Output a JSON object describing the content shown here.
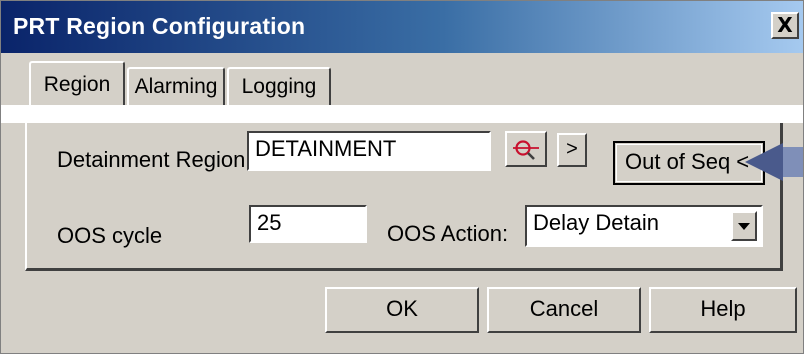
{
  "window": {
    "title": "PRT Region Configuration",
    "close_label": "X"
  },
  "tabs": [
    {
      "label": "Region",
      "active": true
    },
    {
      "label": "Alarming",
      "active": false
    },
    {
      "label": "Logging",
      "active": false
    }
  ],
  "region_tab": {
    "detainment_region_label": "Detainment Region:",
    "detainment_region_value": "DETAINMENT",
    "lookup_icon": "magnifier-icon",
    "next_button_label": ">",
    "out_of_seq_button_label": "Out of Seq <<",
    "oos_cycle_label": "OOS cycle",
    "oos_cycle_value": "25",
    "oos_action_label": "OOS Action:",
    "oos_action_value": "Delay Detain"
  },
  "footer": {
    "ok_label": "OK",
    "cancel_label": "Cancel",
    "help_label": "Help"
  },
  "colors": {
    "title_bar_start": "#0a246a",
    "title_bar_end": "#a6caf0",
    "dialog_face": "#d4d0c8",
    "pointer_arrow": "#4a5a8c",
    "lookup_icon_red": "#c8102e"
  }
}
